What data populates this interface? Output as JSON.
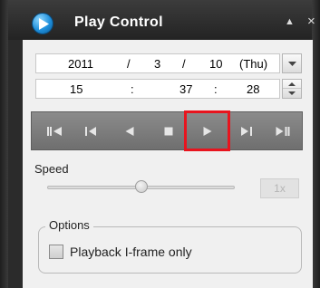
{
  "window": {
    "title": "Play Control",
    "collapse_symbol": "▲",
    "close_symbol": "×"
  },
  "datetime": {
    "year": "2011",
    "month": "3",
    "day": "10",
    "weekday": "(Thu)",
    "date_separator": "/",
    "hour": "15",
    "minute": "37",
    "second": "28",
    "time_separator": ":"
  },
  "controls": [
    {
      "name": "go-to-start-button",
      "icon": "skip-to-start-icon"
    },
    {
      "name": "prev-frame-button",
      "icon": "step-back-icon"
    },
    {
      "name": "reverse-play-button",
      "icon": "reverse-play-icon"
    },
    {
      "name": "stop-button",
      "icon": "stop-icon"
    },
    {
      "name": "play-button",
      "icon": "play-icon",
      "highlighted": true
    },
    {
      "name": "next-frame-button",
      "icon": "step-forward-icon"
    },
    {
      "name": "play-pause-button",
      "icon": "play-pause-icon"
    }
  ],
  "speed": {
    "label": "Speed",
    "value": "1x",
    "level": 0.5
  },
  "options": {
    "legend": "Options",
    "checkbox_label": "Playback I-frame only",
    "checked": false
  },
  "colors": {
    "highlight": "#e8141e",
    "accent": "#1f8fdb"
  }
}
